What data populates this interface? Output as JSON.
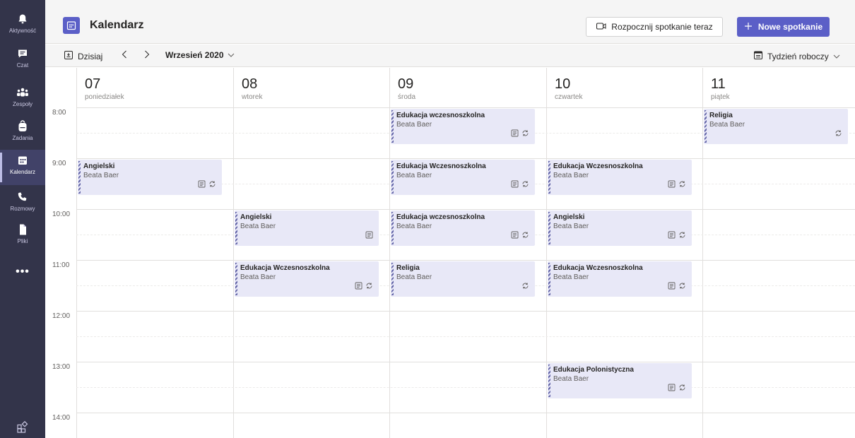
{
  "rail": {
    "items": [
      {
        "label": "Aktywność",
        "icon": "bell-icon"
      },
      {
        "label": "Czat",
        "icon": "chat-icon"
      },
      {
        "label": "Zespoły",
        "icon": "teams-icon"
      },
      {
        "label": "Zadania",
        "icon": "backpack-icon"
      },
      {
        "label": "Kalendarz",
        "icon": "calendar-icon"
      },
      {
        "label": "Rozmowy",
        "icon": "phone-icon"
      },
      {
        "label": "Pliki",
        "icon": "files-icon"
      }
    ],
    "active": "Kalendarz",
    "more_label": "•••"
  },
  "header": {
    "title": "Kalendarz",
    "meet_now_label": "Rozpocznij spotkanie teraz",
    "new_meeting_label": "Nowe spotkanie"
  },
  "toolbar": {
    "today_label": "Dzisiaj",
    "month_label": "Wrzesień 2020",
    "view_label": "Tydzień roboczy"
  },
  "days": [
    {
      "num": "07",
      "name": "poniedziałek"
    },
    {
      "num": "08",
      "name": "wtorek"
    },
    {
      "num": "09",
      "name": "środa"
    },
    {
      "num": "10",
      "name": "czwartek"
    },
    {
      "num": "11",
      "name": "piątek"
    }
  ],
  "hours": [
    "8:00",
    "9:00",
    "10:00",
    "11:00",
    "12:00",
    "13:00",
    "14:00"
  ],
  "events": [
    {
      "day": 0,
      "start": "9:00",
      "title": "Angielski",
      "organizer": "Beata Baer",
      "icons": [
        "meeting-notes-icon",
        "recurring-icon"
      ]
    },
    {
      "day": 1,
      "start": "10:00",
      "title": "Angielski",
      "organizer": "Beata Baer",
      "icons": [
        "meeting-notes-icon"
      ]
    },
    {
      "day": 1,
      "start": "11:00",
      "title": "Edukacja Wczesnoszkolna",
      "organizer": "Beata Baer",
      "icons": [
        "meeting-notes-icon",
        "recurring-icon"
      ]
    },
    {
      "day": 2,
      "start": "8:00",
      "title": "Edukacja wczesnoszkolna",
      "organizer": "Beata Baer",
      "icons": [
        "meeting-notes-icon",
        "recurring-icon"
      ]
    },
    {
      "day": 2,
      "start": "9:00",
      "title": "Edukacja Wczesnoszkolna",
      "organizer": "Beata Baer",
      "icons": [
        "meeting-notes-icon",
        "recurring-icon"
      ]
    },
    {
      "day": 2,
      "start": "10:00",
      "title": "Edukacja wczesnoszkolna",
      "organizer": "Beata Baer",
      "icons": [
        "meeting-notes-icon",
        "recurring-icon"
      ]
    },
    {
      "day": 2,
      "start": "11:00",
      "title": "Religia",
      "organizer": "Beata Baer",
      "icons": [
        "recurring-icon"
      ]
    },
    {
      "day": 3,
      "start": "9:00",
      "title": "Edukacja Wczesnoszkolna",
      "organizer": "Beata Baer",
      "icons": [
        "meeting-notes-icon",
        "recurring-icon"
      ]
    },
    {
      "day": 3,
      "start": "10:00",
      "title": "Angielski",
      "organizer": "Beata Baer",
      "icons": [
        "meeting-notes-icon",
        "recurring-icon"
      ]
    },
    {
      "day": 3,
      "start": "11:00",
      "title": "Edukacja Wczesnoszkolna",
      "organizer": "Beata Baer",
      "icons": [
        "meeting-notes-icon",
        "recurring-icon"
      ]
    },
    {
      "day": 3,
      "start": "13:00",
      "title": "Edukacja Polonistyczna",
      "organizer": "Beata Baer",
      "icons": [
        "meeting-notes-icon",
        "recurring-icon"
      ]
    },
    {
      "day": 4,
      "start": "8:00",
      "title": "Religia",
      "organizer": "Beata Baer",
      "icons": [
        "recurring-icon"
      ]
    }
  ],
  "colors": {
    "brand": "#5b5fc7",
    "rail": "#33344a",
    "event_bg": "#e8e8f7",
    "event_stripe": "#6264a7"
  }
}
